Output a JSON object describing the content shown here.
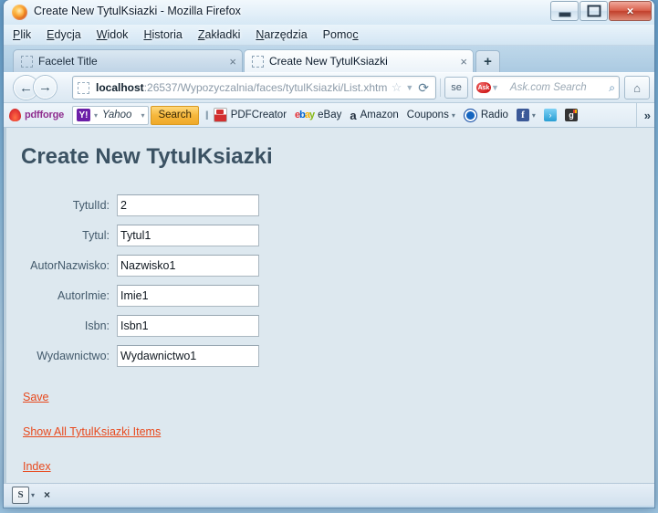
{
  "window": {
    "title": "Create New TytulKsiazki - Mozilla Firefox",
    "app_icon": "firefox-icon",
    "minimize_label": "Minimize",
    "maximize_label": "Maximize",
    "close_label": "Close"
  },
  "menubar": {
    "items": [
      {
        "label": "Plik",
        "accel": "P"
      },
      {
        "label": "Edycja",
        "accel": "E"
      },
      {
        "label": "Widok",
        "accel": "W"
      },
      {
        "label": "Historia",
        "accel": "H"
      },
      {
        "label": "Zakładki",
        "accel": "Z"
      },
      {
        "label": "Narzędzia",
        "accel": "N"
      },
      {
        "label": "Pomoc",
        "accel": "c"
      }
    ]
  },
  "tabs": {
    "items": [
      {
        "title": "Facelet Title",
        "active": false,
        "close_label": "×"
      },
      {
        "title": "Create New TytulKsiazki",
        "active": true,
        "close_label": "×"
      }
    ],
    "new_tab_label": "+"
  },
  "navbar": {
    "back_label": "←",
    "forward_label": "→",
    "url_host": "localhost",
    "url_rest": ":26537/Wypozyczalnia/faces/tytulKsiazki/List.xhtm",
    "url_full": "localhost:26537/Wypozyczalnia/faces/tytulKsiazki/List.xhtm",
    "star_label": "☆",
    "dropdown_label": "▼",
    "reload_label": "⟳",
    "scribblebtn_label": "se",
    "search_engine": "Ask",
    "search_placeholder": "Ask.com Search",
    "search_value": "",
    "magnifier_label": "⌕",
    "home_label": "⌂"
  },
  "bookmarks": {
    "pdfforge_label": "pdfforge",
    "yahoo_icon_label": "Y!",
    "yahoo_label": "Yahoo",
    "yahoo_dropdown": "▾",
    "yahoo_search_button": "Search",
    "items": [
      {
        "label": "PDFCreator",
        "icon": "acrobat-icon"
      },
      {
        "label": "eBay",
        "icon": "ebay-icon"
      },
      {
        "label": "Amazon",
        "icon": "amazon-icon"
      },
      {
        "label": "Coupons",
        "icon": "coupons-icon",
        "dropdown": "▾"
      },
      {
        "label": "Radio",
        "icon": "radio-icon"
      }
    ],
    "social": [
      {
        "name": "facebook-icon",
        "glyph": "f",
        "dropdown": "▾"
      },
      {
        "name": "twitter-icon",
        "glyph": "t"
      },
      {
        "name": "googleplus-icon",
        "glyph": "g"
      }
    ],
    "overflow_label": "»"
  },
  "page": {
    "heading": "Create New TytulKsiazki",
    "fields": [
      {
        "label": "TytulId:",
        "value": "2",
        "name": "tytulid"
      },
      {
        "label": "Tytul:",
        "value": "Tytul1",
        "name": "tytul"
      },
      {
        "label": "AutorNazwisko:",
        "value": "Nazwisko1",
        "name": "autornazwisko"
      },
      {
        "label": "AutorImie:",
        "value": "Imie1",
        "name": "autorimie"
      },
      {
        "label": "Isbn:",
        "value": "Isbn1",
        "name": "isbn"
      },
      {
        "label": "Wydawnictwo:",
        "value": "Wydawnictwo1",
        "name": "wydawnictwo"
      }
    ],
    "links": [
      {
        "label": "Save",
        "name": "save-link"
      },
      {
        "label": "Show All TytulKsiazki Items",
        "name": "show-all-link"
      },
      {
        "label": "Index",
        "name": "index-link"
      }
    ],
    "colors": {
      "background": "#dde8ef",
      "heading": "#3b5263",
      "label": "#42596b",
      "link": "#e8491d"
    }
  },
  "statusbar": {
    "addon_icon_label": "S",
    "addon_dropdown": "▾",
    "close_label": "×"
  }
}
